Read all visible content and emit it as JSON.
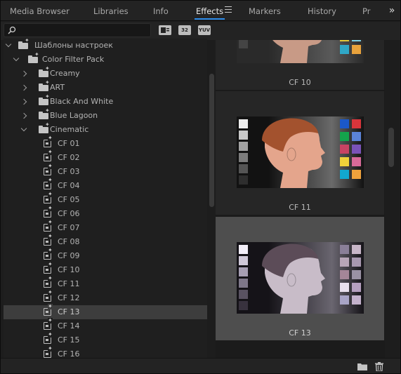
{
  "tabs": [
    {
      "label": "Media Browser",
      "active": false
    },
    {
      "label": "Libraries",
      "active": false
    },
    {
      "label": "Info",
      "active": false
    },
    {
      "label": "Effects",
      "active": true
    },
    {
      "label": "Markers",
      "active": false
    },
    {
      "label": "History",
      "active": false
    },
    {
      "label": "Pr",
      "active": false
    }
  ],
  "tab_menu_icon": "hamburger-menu-icon",
  "overflow_icon": "double-chevron-right-icon",
  "search": {
    "value": "",
    "placeholder": "",
    "icon": "magnifier-icon"
  },
  "filter_buttons": [
    {
      "icon": "accelerated-effects-icon",
      "text": ""
    },
    {
      "icon": "32-bit-color-icon",
      "text": "32"
    },
    {
      "icon": "yuv-effects-icon",
      "text": "YUV"
    }
  ],
  "tree": [
    {
      "label": "Шаблоны настроек",
      "type": "folder",
      "depth": 0,
      "expanded": true
    },
    {
      "label": "Color Filter Pack",
      "type": "folder",
      "depth": 1,
      "expanded": true
    },
    {
      "label": "Creamy",
      "type": "folder",
      "depth": 2,
      "expanded": false
    },
    {
      "label": "ART",
      "type": "folder",
      "depth": 2,
      "expanded": false
    },
    {
      "label": "Black And White",
      "type": "folder",
      "depth": 2,
      "expanded": false
    },
    {
      "label": "Blue Lagoon",
      "type": "folder",
      "depth": 2,
      "expanded": false
    },
    {
      "label": "Cinematic",
      "type": "folder",
      "depth": 2,
      "expanded": true
    },
    {
      "label": "CF 01",
      "type": "preset",
      "depth": 3
    },
    {
      "label": "CF 02",
      "type": "preset",
      "depth": 3
    },
    {
      "label": "CF 03",
      "type": "preset",
      "depth": 3
    },
    {
      "label": "CF 04",
      "type": "preset",
      "depth": 3
    },
    {
      "label": "CF 05",
      "type": "preset",
      "depth": 3
    },
    {
      "label": "CF 06",
      "type": "preset",
      "depth": 3
    },
    {
      "label": "CF 07",
      "type": "preset",
      "depth": 3
    },
    {
      "label": "CF 08",
      "type": "preset",
      "depth": 3
    },
    {
      "label": "CF 09",
      "type": "preset",
      "depth": 3
    },
    {
      "label": "CF 10",
      "type": "preset",
      "depth": 3
    },
    {
      "label": "CF 11",
      "type": "preset",
      "depth": 3
    },
    {
      "label": "CF 12",
      "type": "preset",
      "depth": 3
    },
    {
      "label": "CF 13",
      "type": "preset",
      "depth": 3,
      "selected": true
    },
    {
      "label": "CF 14",
      "type": "preset",
      "depth": 3
    },
    {
      "label": "CF 15",
      "type": "preset",
      "depth": 3
    },
    {
      "label": "CF 16",
      "type": "preset",
      "depth": 3
    }
  ],
  "previews": [
    {
      "label": "CF 10",
      "selected": false,
      "bg": [
        "#2a2a2a",
        "#5a5a5a"
      ],
      "skin": "#c89a86",
      "hair": "#3a2a22",
      "gray_swatches": [
        "#d8d8d8",
        "#b0b0b0",
        "#8a8a8a",
        "#666666",
        "#444444",
        "#2a2a2a"
      ],
      "color_swatches": [
        "#1a5fb4",
        "#2fa84f",
        "#6d8fd6",
        "#d04a5a",
        "#8a5cc0",
        "#f29bb0",
        "#e3c93a",
        "#7fd0e6",
        "#2fa7c6",
        "#e8a23c"
      ]
    },
    {
      "label": "CF 11",
      "selected": false,
      "bg": [
        "#121212",
        "#6a6a6a"
      ],
      "skin": "#e4a58c",
      "hair": "#a3522e",
      "gray_swatches": [
        "#ececec",
        "#c8c8c8",
        "#a2a2a2",
        "#7c7c7c",
        "#555555",
        "#2e2e2e"
      ],
      "color_swatches": [
        "#1b58c8",
        "#d8353b",
        "#14a34c",
        "#5b83d8",
        "#c94363",
        "#7a52b8",
        "#f0d23a",
        "#d86a99",
        "#11a8cf",
        "#f0a23c"
      ]
    },
    {
      "label": "CF 13",
      "selected": true,
      "bg": [
        "#151318",
        "#6a6670"
      ],
      "skin": "#c8bcc8",
      "hair": "#5c4c58",
      "gray_swatches": [
        "#f2eef8",
        "#cfc8d8",
        "#a69eb2",
        "#7e7789",
        "#595261",
        "#38323e"
      ],
      "color_swatches": [
        "#8a7f98",
        "#c8b6c8",
        "#b8a6b8",
        "#a898b0",
        "#a48698",
        "#9a92a4",
        "#e8e0ee",
        "#b6a0c0",
        "#a8a4c6",
        "#c4b2cc"
      ]
    }
  ],
  "bottom_icons": [
    "new-folder-icon",
    "trash-icon"
  ]
}
